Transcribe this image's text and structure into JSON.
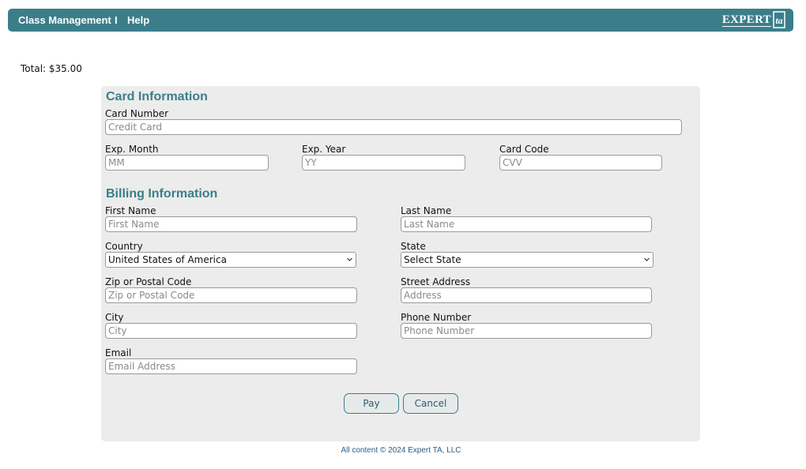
{
  "header": {
    "nav_class_management": "Class Management",
    "nav_separator": "I",
    "nav_help": "Help",
    "logo_text": "EXPERT",
    "logo_mark": "ta",
    "brand_color": "#3b7e8a"
  },
  "order": {
    "total": "Total: $35.00"
  },
  "card": {
    "title": "Card Information",
    "number_label": "Card Number",
    "number_placeholder": "Credit Card",
    "month_label": "Exp. Month",
    "month_placeholder": "MM",
    "year_label": "Exp. Year",
    "year_placeholder": "YY",
    "code_label": "Card Code",
    "code_placeholder": "CVV"
  },
  "billing": {
    "title": "Billing Information",
    "first_name_label": "First Name",
    "first_name_placeholder": "First Name",
    "last_name_label": "Last Name",
    "last_name_placeholder": "Last Name",
    "country_label": "Country",
    "country_value": "United States of America",
    "state_label": "State",
    "state_value": "Select State",
    "zip_label": "Zip or Postal Code",
    "zip_placeholder": "Zip or Postal Code",
    "street_label": "Street Address",
    "street_placeholder": "Address",
    "city_label": "City",
    "city_placeholder": "City",
    "phone_label": "Phone Number",
    "phone_placeholder": "Phone Number",
    "email_label": "Email",
    "email_placeholder": "Email Address"
  },
  "actions": {
    "pay_label": "Pay",
    "cancel_label": "Cancel"
  },
  "footer": {
    "copyright": "All content © 2024 Expert TA, LLC"
  }
}
